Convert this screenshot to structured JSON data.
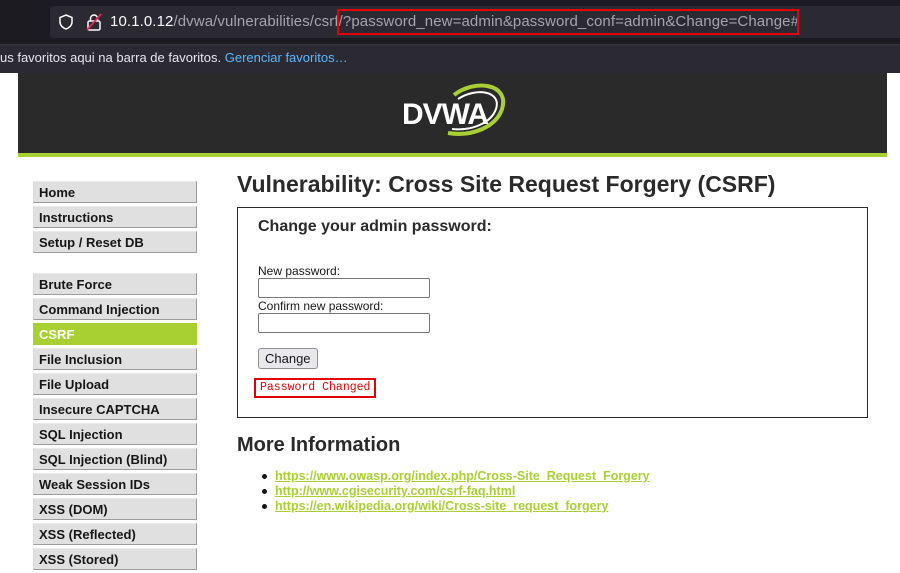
{
  "browser": {
    "url_host": "10.1.0.12",
    "url_path": "/dvwa/vulnerabilities/csrf/",
    "url_query": "?password_new=admin&password_conf=admin&Change=Change#",
    "bookmarks_text": "us favoritos aqui na barra de favoritos.",
    "bookmarks_link": "Gerenciar favoritos…"
  },
  "header": {
    "logo_text": "DVWA"
  },
  "menu": {
    "group1": [
      "Home",
      "Instructions",
      "Setup / Reset DB"
    ],
    "group2": [
      "Brute Force",
      "Command Injection",
      "CSRF",
      "File Inclusion",
      "File Upload",
      "Insecure CAPTCHA",
      "SQL Injection",
      "SQL Injection (Blind)",
      "Weak Session IDs",
      "XSS (DOM)",
      "XSS (Reflected)",
      "XSS (Stored)"
    ],
    "active": "CSRF"
  },
  "main": {
    "title": "Vulnerability: Cross Site Request Forgery (CSRF)",
    "form_title": "Change your admin password:",
    "new_password_label": "New password:",
    "confirm_password_label": "Confirm new password:",
    "change_button": "Change",
    "status_message": "Password Changed"
  },
  "more_info": {
    "title": "More Information",
    "links": [
      "https://www.owasp.org/index.php/Cross-Site_Request_Forgery",
      "http://www.cgisecurity.com/csrf-faq.html",
      "https://en.wikipedia.org/wiki/Cross-site_request_forgery"
    ]
  },
  "colors": {
    "accent": "#a9d033",
    "header": "#2a2a2a",
    "highlight": "#e20000"
  }
}
